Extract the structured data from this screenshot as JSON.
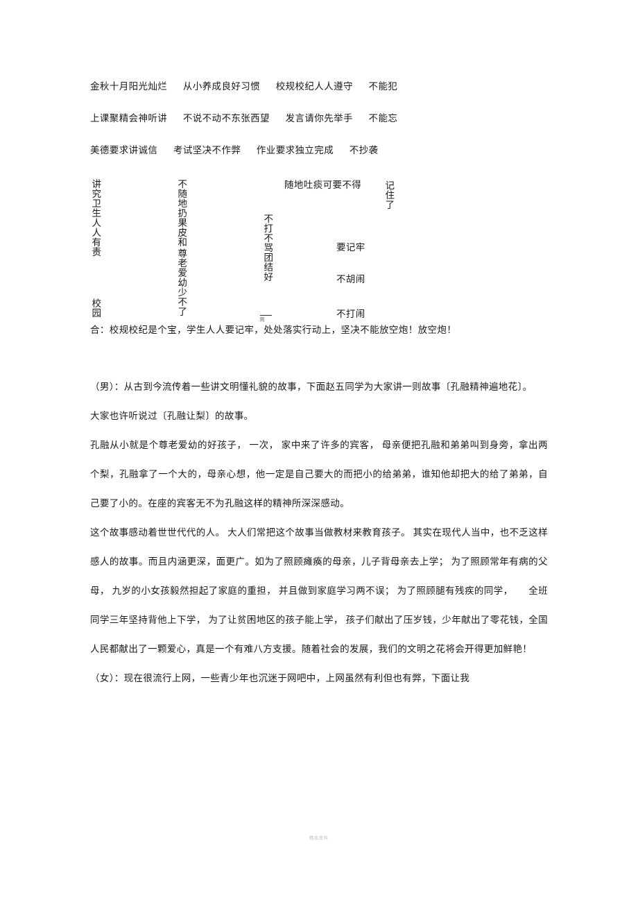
{
  "document": {
    "slogans": [
      "金秋十月阳光灿烂      从小养成良好习惯      校规校纪人人遵守      不能犯",
      "上课聚精会神听讲      不说不动不东张西望      发言请你先举手      不能忘",
      "美德要求讲诚信      考试坚决不作弊      作业要求独立完成      不抄袭"
    ],
    "vertical_block": {
      "col1_top": "讲究卫生人人有责",
      "col1_bottom": "校园",
      "col2_top": "不随地扔果皮和",
      "col2_bottom": "尊老爱幼少不了",
      "col3": "不打不骂团结好",
      "snippet_spit": "随地吐痰可要不得",
      "snippet_remember": "记住了",
      "snippet_note1": "要记牢",
      "snippet_note2": "不胡闹",
      "snippet_note3": "不打闹",
      "ghost_char": "离"
    },
    "he_line": "合：校规校纪是个宝，学生人人要记牢，处处落实行动上，坚决不能放空炮！放空炮！",
    "paragraphs": [
      "（男）：从古到今流传着一些讲文明懂礼貌的故事，下面赵五同学为大家讲一则故事〔孔融精神遍地花〕。",
      "大家也许听说过〔孔融让梨〕的故事。",
      "孔融从小就是个尊老爱幼的好孩子， 一次， 家中来了许多的宾客， 母亲便把孔融和弟弟叫到身旁，拿出两个梨，孔融拿了一个大的，母亲心想，他一定是自己要大的而把小的给弟弟，谁知他却把大的给了弟弟，自己要了小的。在座的宾客无不为孔融这样的精神所深深感动。",
      "这个故事感动着世世代代的人。 大人们常把这个故事当做教材来教育孩子。 其实在现代人当中，也不乏这样感人的故事。而且内涵更深，面更广。如为了照顾瘫痪的母亲，儿子背母亲去上学； 为了照顾常年有病的父母， 九岁的小女孩毅然担起了家庭的重担， 并且做到家庭学习两不误； 为了照顾腿有残疾的同学，      全班同学三年坚持背他上下学， 为了让贫困地区的孩子能上学， 孩子们献出了压岁钱，少年献出了零花钱，全国人民都献出了一颗爱心，真是一个有难八方支援。随着社会的发展，我们的文明之花将会开得更加鲜艳！",
      "（女）：现在很流行上网，一些青少年也沉迷于网吧中，上网虽然有利但也有弊，下面让我"
    ],
    "watermark": "精品资料"
  }
}
